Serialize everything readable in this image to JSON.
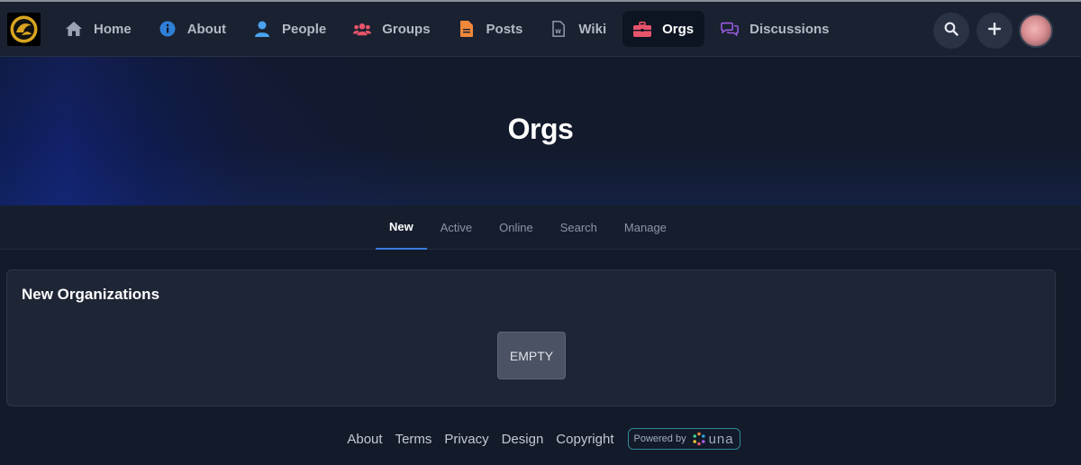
{
  "nav": {
    "items": [
      {
        "label": "Home",
        "icon": "home-icon",
        "color": "#9aa3b2"
      },
      {
        "label": "About",
        "icon": "info-icon",
        "color": "#3a8fe0"
      },
      {
        "label": "People",
        "icon": "person-icon",
        "color": "#4ba3ee"
      },
      {
        "label": "Groups",
        "icon": "users-icon",
        "color": "#e8546a"
      },
      {
        "label": "Posts",
        "icon": "file-icon",
        "color": "#f0883a"
      },
      {
        "label": "Wiki",
        "icon": "wiki-file-icon",
        "color": "#9aa3b2"
      },
      {
        "label": "Orgs",
        "icon": "briefcase-icon",
        "color": "#e8546a"
      },
      {
        "label": "Discussions",
        "icon": "comments-icon",
        "color": "#a35ee8"
      }
    ],
    "active": "Orgs"
  },
  "page": {
    "title": "Orgs"
  },
  "subnav": {
    "tabs": [
      "New",
      "Active",
      "Online",
      "Search",
      "Manage"
    ],
    "active": "New"
  },
  "card": {
    "title": "New Organizations",
    "empty_label": "EMPTY"
  },
  "footer": {
    "links": [
      "About",
      "Terms",
      "Privacy",
      "Design",
      "Copyright"
    ],
    "powered_by": "Powered by",
    "brand": "una"
  },
  "colors": {
    "accent": "#3a7be0",
    "background": "#131a29",
    "topbar": "#1a2232"
  }
}
